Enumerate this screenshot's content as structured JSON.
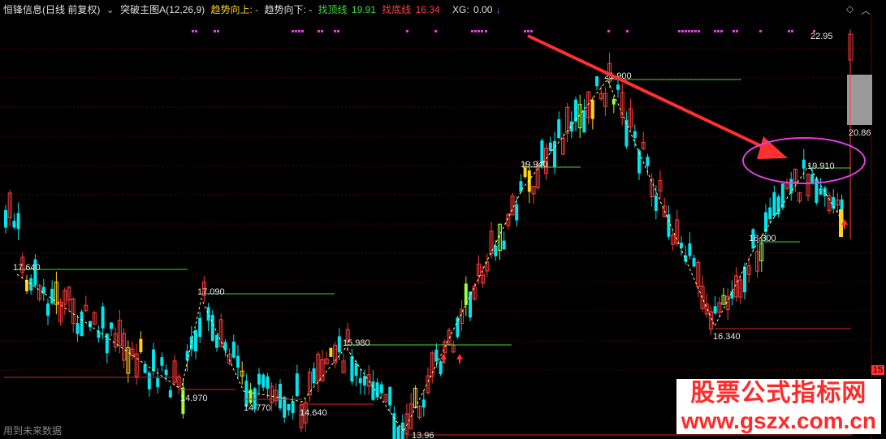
{
  "header": {
    "title": "恒锋信息(日线 前复权)",
    "indicator": "突破主图A(12,26,9)",
    "trend_up_label": "趋势向上:",
    "trend_up_value": "-",
    "trend_down_label": "趋势向下:",
    "trend_down_value": "-",
    "top_line_label": "找顶线",
    "top_line_value": "19.91",
    "bottom_line_label": "找底线",
    "bottom_line_value": "16.34",
    "xg_label": "XG:",
    "xg_value": "0.00",
    "xg_arrow": "↓"
  },
  "labels": {
    "l1": "17.640",
    "l2": "17.090",
    "l3": "14.970",
    "l4": "14.770",
    "l5": "14.640",
    "l6": "15.980",
    "l7": "13.96",
    "l8": "19.940",
    "l9": "21.900",
    "l10": "18.300",
    "l11": "16.340",
    "l12": "19.910",
    "l13": "22.95",
    "l14": "20.86"
  },
  "price_tag": "15",
  "footer": "用到未来数据",
  "watermark": {
    "line1": "股票公式指标网",
    "line2": "www.gszx.com.cn"
  },
  "colors": {
    "up": "#ff3b3b",
    "down": "#00e5ee",
    "yellow": "#ffd11a",
    "green": "#9cff3a",
    "top_line": "#3cdc3c",
    "bottom_line": "#e02020",
    "zigzag": "#ffff80",
    "arrow": "#ff3030",
    "ellipse": "#e040e0",
    "signal_dots": "#e040e0"
  }
}
